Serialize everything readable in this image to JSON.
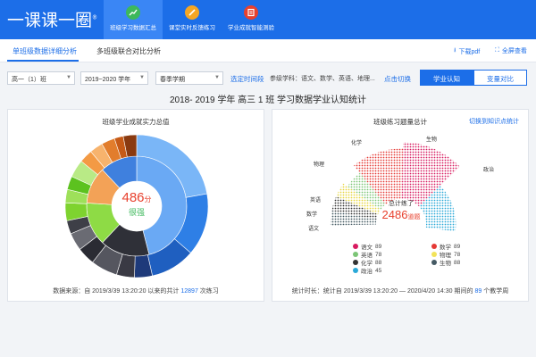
{
  "header": {
    "logo": "一课课一圈",
    "logo_mark": "®",
    "tabs": [
      {
        "label": "班级学习数据汇总",
        "icon": "chart-icon",
        "color": "#3db85b"
      },
      {
        "label": "课堂实时反馈练习",
        "icon": "pencil-icon",
        "color": "#f5a623"
      },
      {
        "label": "学业成就智能测验",
        "icon": "test-icon",
        "color": "#e8412e"
      }
    ]
  },
  "subtabs": {
    "single": "单班级数据详细分析",
    "multi": "多班级联合对比分析",
    "download": "下载pdf",
    "fullscreen": "全屏查看"
  },
  "filters": {
    "class": "高一（1）班",
    "year": "2019~2020 学年",
    "term": "春季学期",
    "time_link": "选定时间段",
    "subjects": "参级学科：语文、数学、英语、地理...",
    "switch_link": "点击切换",
    "seg_on": "学业认知",
    "seg_off": "变量对比"
  },
  "page_title": "2018- 2019 学年 高三 1 班 学习数据学业认知统计",
  "left_panel": {
    "title": "班级学业成就实力总值",
    "value": "486",
    "unit": "分",
    "level": "很强",
    "foot_prefix": "数据来源：自 2019/3/39 13:20:20 以来的共计 ",
    "foot_count": "12897",
    "foot_suffix": " 次练习"
  },
  "right_panel": {
    "title": "班级练习题量总计",
    "switch": "切换到知识点统计",
    "center_label": "总计练了",
    "value": "2486",
    "unit": "道题",
    "foot_prefix": "统计时长：统计自 2019/3/39 13:20:20 — 2020/4/20 14:30 期间的 ",
    "foot_count": "89",
    "foot_suffix": " 个教学周"
  },
  "chart_data": [
    {
      "type": "pie",
      "inner_ring": {
        "values": [
          46,
          16,
          14,
          12,
          12
        ],
        "colors": [
          "#6aa9f4",
          "#2f3038",
          "#8edb45",
          "#f3a257",
          "#3f80de"
        ]
      },
      "outer_ring": {
        "values": [
          22,
          14,
          10,
          4,
          4,
          6,
          4,
          4,
          3,
          4,
          3,
          3,
          4,
          3,
          3,
          3,
          2,
          3
        ],
        "colors": [
          "#7ab6f7",
          "#2e7fe6",
          "#1f5fc0",
          "#1e3a7a",
          "#3a3a44",
          "#55565f",
          "#2a2b33",
          "#6a6b73",
          "#3e3f47",
          "#7ed32f",
          "#9ee05a",
          "#5cc21f",
          "#b9ea86",
          "#f39a44",
          "#f7b36d",
          "#e27d2c",
          "#c65a16",
          "#8a3a10"
        ]
      }
    },
    {
      "type": "pie",
      "categories": [
        "语文",
        "数学",
        "英语",
        "物理",
        "化学",
        "生物",
        "政治"
      ],
      "values": [
        89,
        78,
        78,
        88,
        88,
        88,
        45
      ],
      "colors": [
        "#d81b60",
        "#e53935",
        "#7cc576",
        "#f2e35a",
        "#333333",
        "#455a64",
        "#2aa9d8"
      ]
    }
  ],
  "legend": [
    {
      "name": "语文",
      "value": "89",
      "color": "#d81b60"
    },
    {
      "name": "数学",
      "value": "89",
      "color": "#e53935"
    },
    {
      "name": "英语",
      "value": "78",
      "color": "#7cc576"
    },
    {
      "name": "物理",
      "value": "78",
      "color": "#f2e35a"
    },
    {
      "name": "化学",
      "value": "88",
      "color": "#333333"
    },
    {
      "name": "生物",
      "value": "88",
      "color": "#455a64"
    },
    {
      "name": "政治",
      "value": "45",
      "color": "#2aa9d8"
    }
  ],
  "seg_labels": [
    "生物",
    "化学",
    "物理",
    "英语",
    "数学",
    "语文",
    "政治"
  ]
}
